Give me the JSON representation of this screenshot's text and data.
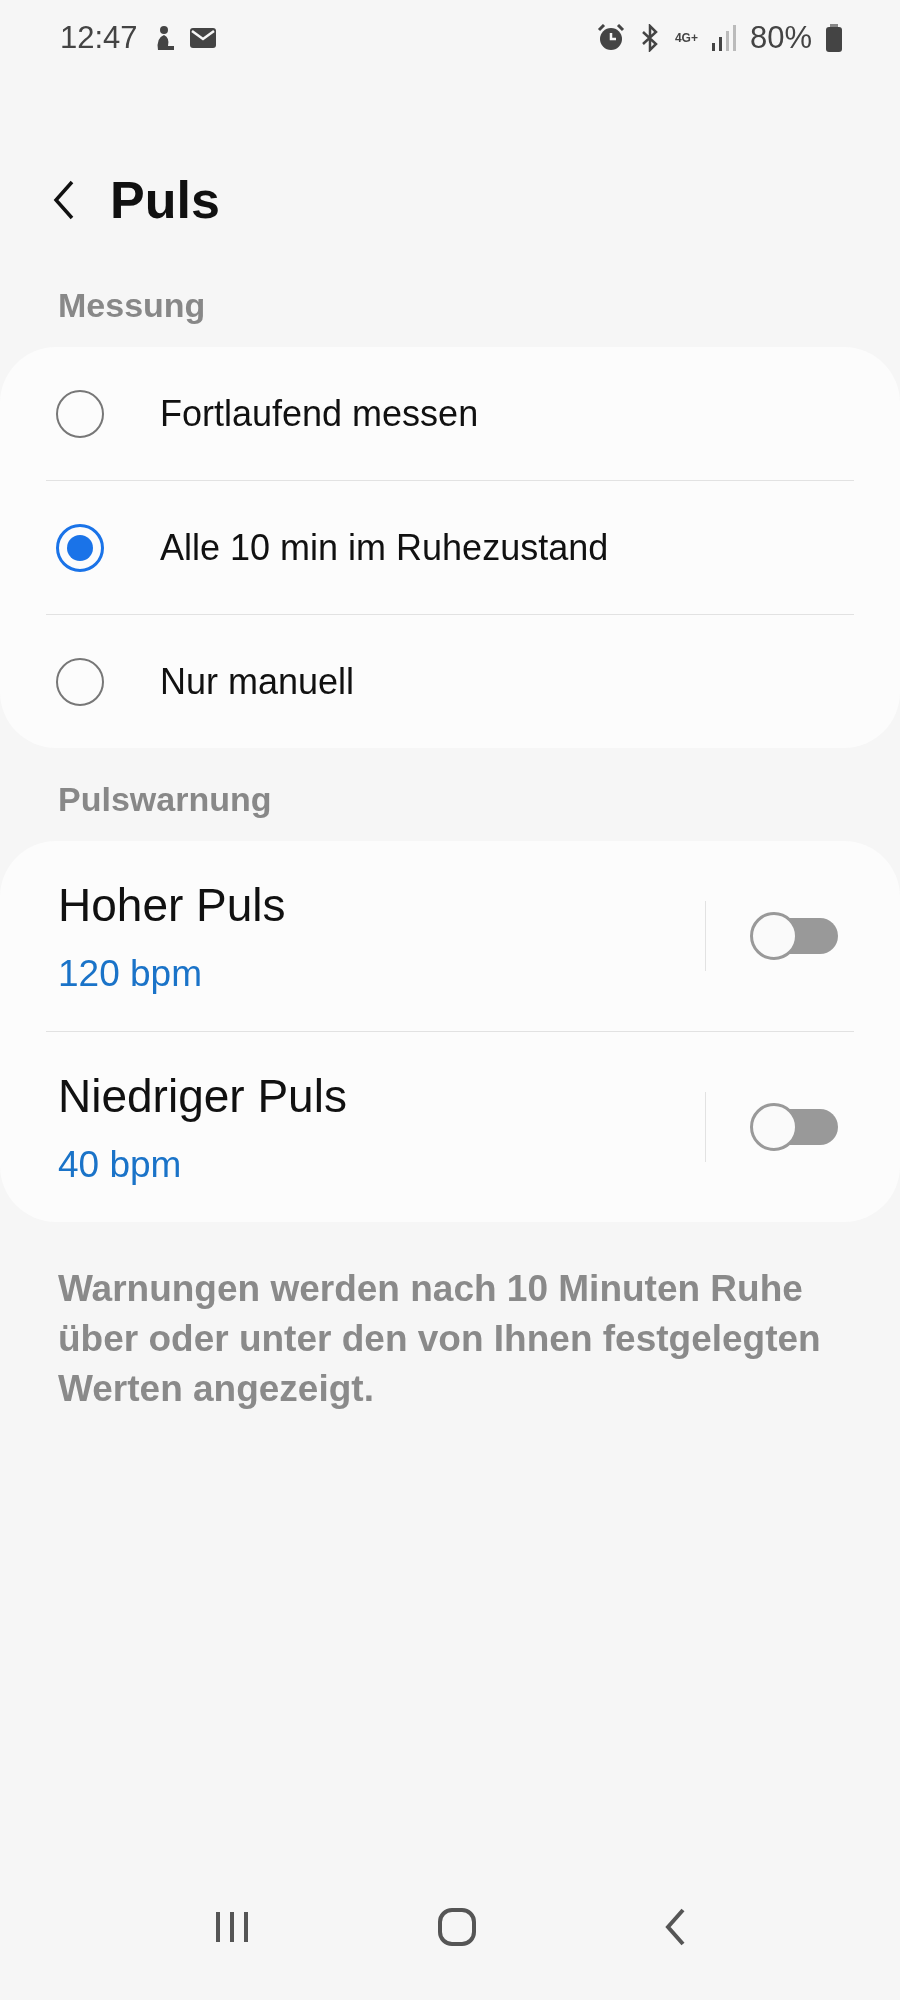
{
  "status_bar": {
    "time": "12:47",
    "network": "4G+",
    "battery": "80%"
  },
  "header": {
    "title": "Puls"
  },
  "sections": [
    {
      "title": "Messung",
      "kind": "radio",
      "items": [
        {
          "label": "Fortlaufend messen",
          "selected": false
        },
        {
          "label": "Alle 10 min im Ruhezustand",
          "selected": true
        },
        {
          "label": "Nur manuell",
          "selected": false
        }
      ]
    },
    {
      "title": "Pulswarnung",
      "kind": "switch",
      "items": [
        {
          "label": "Hoher Puls",
          "value": "120 bpm",
          "on": false
        },
        {
          "label": "Niedriger Puls",
          "value": "40 bpm",
          "on": false
        }
      ]
    }
  ],
  "footnote": "Warnungen werden nach 10 Minuten Ruhe über oder unter den von Ihnen festgelegten Werten angezeigt."
}
